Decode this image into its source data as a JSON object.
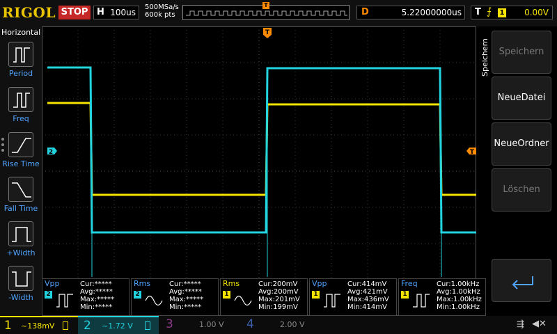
{
  "brand": "RIGOL",
  "run_state": "STOP",
  "timebase": {
    "label": "H",
    "value": "100us"
  },
  "sample": {
    "rate": "500MSa/s",
    "depth": "600k pts"
  },
  "trigger_position_marker": "T",
  "delay": {
    "label": "D",
    "value": "5.22000000us"
  },
  "trigger": {
    "label": "T",
    "source": "1",
    "level": "0.00V"
  },
  "left_panel": {
    "title": "Horizontal",
    "items": [
      {
        "label": "Period"
      },
      {
        "label": "Freq"
      },
      {
        "label": "Rise Time"
      },
      {
        "label": "Fall Time"
      },
      {
        "label": "+Width"
      },
      {
        "label": "-Width"
      }
    ]
  },
  "grid_markers": {
    "ch2": "2",
    "trig_top": "T",
    "trig_right": "T"
  },
  "right_menu": {
    "title": "Speichern",
    "buttons": [
      {
        "label": "Speichern",
        "enabled": false
      },
      {
        "label": "NeueDatei",
        "enabled": true
      },
      {
        "label": "NeueOrdner",
        "enabled": true
      },
      {
        "label": "Löschen",
        "enabled": false
      }
    ]
  },
  "measurements": [
    {
      "name": "Vpp",
      "ch": "2",
      "color": "#22d3e0",
      "cur": "Cur:*****",
      "avg": "Avg:*****",
      "max": "Max:*****",
      "min": "Min:*****"
    },
    {
      "name": "Rms",
      "ch": "2",
      "color": "#22d3e0",
      "cur": "Cur:*****",
      "avg": "Avg:*****",
      "max": "Max:*****",
      "min": "Min:*****"
    },
    {
      "name": "Rms",
      "ch": "1",
      "color": "#f5e400",
      "cur": "Cur:200mV",
      "avg": "Avg:200mV",
      "max": "Max:201mV",
      "min": "Min:199mV"
    },
    {
      "name": "Vpp",
      "ch": "1",
      "color": "#f5e400",
      "cur": "Cur:414mV",
      "avg": "Avg:421mV",
      "max": "Max:436mV",
      "min": "Min:414mV"
    },
    {
      "name": "Freq",
      "ch": "1",
      "color": "#f5e400",
      "cur": "Cur:1.00kHz",
      "avg": "Avg:1.00kHz",
      "max": "Max:1.00kHz",
      "min": "Min:1.00kHz"
    }
  ],
  "channels": [
    {
      "num": "1",
      "scale": "~138mV",
      "color": "#f5e400"
    },
    {
      "num": "2",
      "scale": "~1.72 V",
      "color": "#22d3e0"
    },
    {
      "num": "3",
      "scale": "1.00 V",
      "color": "#8a3a8a"
    },
    {
      "num": "4",
      "scale": "2.00 V",
      "color": "#3a5fa8"
    }
  ],
  "colors": {
    "ch1": "#f5e400",
    "ch2": "#22d3e0",
    "trigger": "#ff8a00",
    "accent": "#4fa3ff"
  }
}
